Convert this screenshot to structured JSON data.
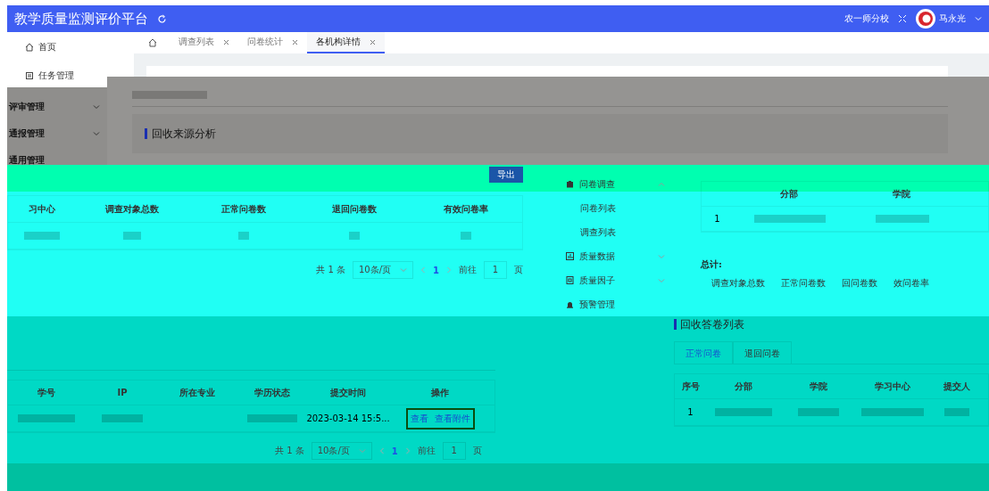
{
  "header": {
    "title": "教学质量监测评价平台",
    "org": "农一师分校",
    "user": "马永光"
  },
  "sidebar": {
    "items": [
      {
        "label": "首页"
      },
      {
        "label": "任务管理"
      }
    ]
  },
  "tabs": [
    {
      "label": "调查列表",
      "selected": false
    },
    {
      "label": "问卷统计",
      "selected": false
    },
    {
      "label": "各机构详情",
      "selected": true
    }
  ],
  "review_area": {
    "nav": [
      {
        "label": "评审管理",
        "kind": "group"
      },
      {
        "label": "通报管理",
        "kind": "group"
      },
      {
        "label": "通用管理",
        "kind": "item"
      }
    ],
    "section_title": "回收来源分析"
  },
  "source_panel": {
    "export": "导出",
    "columns": [
      "习中心",
      "调查对象总数",
      "正常问卷数",
      "退回问卷数",
      "有效问卷率"
    ],
    "pager": {
      "total": "共 1 条",
      "page_size": "10条/页",
      "page": "1",
      "goto": "前往",
      "goto_value": "1",
      "unit": "页"
    }
  },
  "menu": {
    "items": [
      {
        "label": "问卷调查",
        "kind": "group",
        "expanded": true,
        "children": [
          {
            "label": "问卷列表"
          },
          {
            "label": "调查列表"
          }
        ]
      },
      {
        "label": "质量数据",
        "kind": "group",
        "expanded": false
      },
      {
        "label": "质量因子",
        "kind": "group",
        "expanded": false
      },
      {
        "label": "预警管理",
        "kind": "item"
      }
    ]
  },
  "summary_panel": {
    "columns": [
      "分部",
      "学院"
    ],
    "rows": [
      {
        "index": "1"
      }
    ],
    "total_label": "总计:",
    "totals": [
      "调查对象总数",
      "正常问卷数",
      "回问卷数",
      "效问卷率"
    ]
  },
  "detail_panel": {
    "columns": [
      "学号",
      "IP",
      "所在专业",
      "学历状态",
      "提交时间",
      "操作"
    ],
    "rows": [
      {
        "submitted": "2023-03-14 15:5...",
        "actions": [
          "查看",
          "查看附件"
        ]
      }
    ],
    "pager": {
      "total": "共 1 条",
      "page_size": "10条/页",
      "page": "1",
      "goto": "前往",
      "goto_value": "1",
      "unit": "页"
    }
  },
  "answers_panel": {
    "title": "回收答卷列表",
    "tabs": [
      {
        "label": "正常问卷",
        "selected": true
      },
      {
        "label": "退回问卷",
        "selected": false
      }
    ],
    "columns": [
      "序号",
      "分部",
      "学院",
      "学习中心",
      "提交人"
    ],
    "rows": [
      {
        "index": "1"
      }
    ]
  }
}
